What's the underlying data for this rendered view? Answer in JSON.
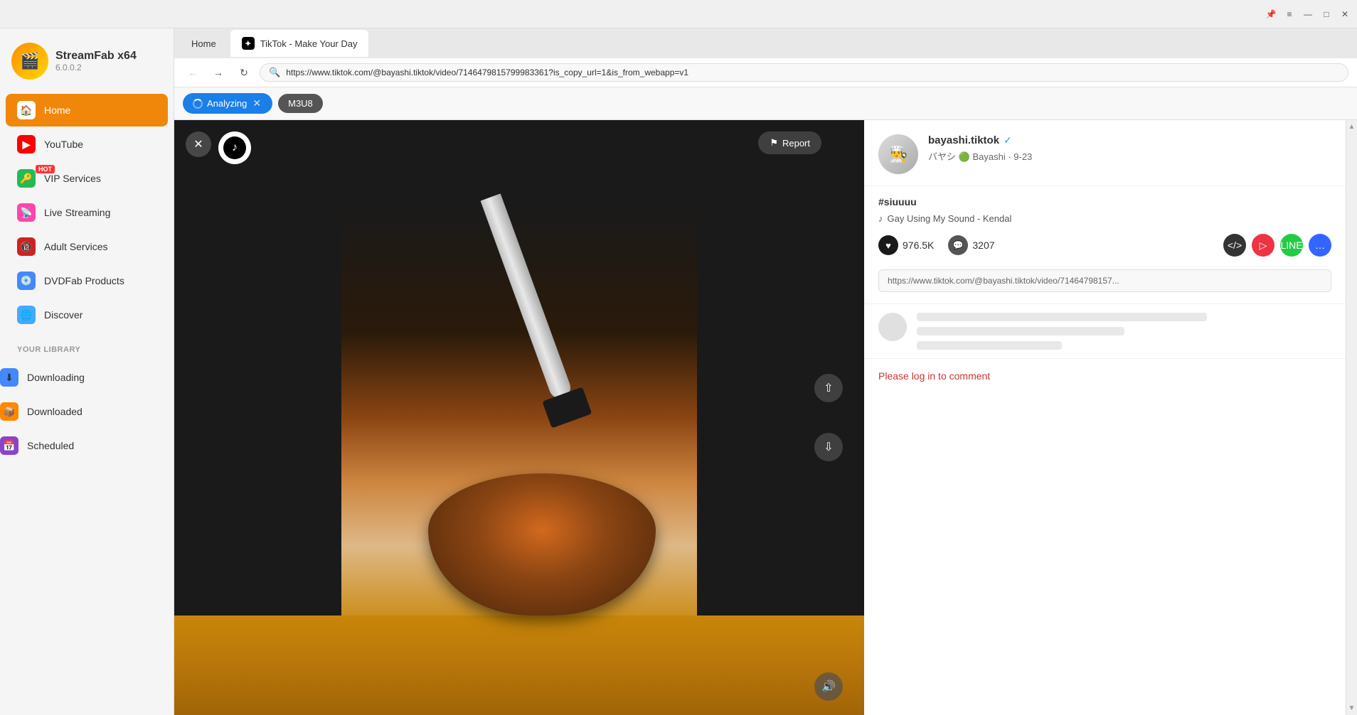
{
  "app": {
    "name": "StreamFab",
    "arch": "x64",
    "version": "6.0.0.2"
  },
  "titleBar": {
    "pin_label": "📌",
    "menu_label": "≡",
    "minimize_label": "—",
    "maximize_label": "□",
    "close_label": "✕"
  },
  "sidebar": {
    "items": [
      {
        "id": "home",
        "label": "Home",
        "active": true
      },
      {
        "id": "youtube",
        "label": "YouTube",
        "active": false
      },
      {
        "id": "vip",
        "label": "VIP Services",
        "active": false,
        "badge": "HOT"
      },
      {
        "id": "live",
        "label": "Live Streaming",
        "active": false
      },
      {
        "id": "adult",
        "label": "Adult Services",
        "active": false
      },
      {
        "id": "dvd",
        "label": "DVDFab Products",
        "active": false
      },
      {
        "id": "discover",
        "label": "Discover",
        "active": false
      }
    ],
    "library": {
      "label": "YOUR LIBRARY",
      "items": [
        {
          "id": "downloading",
          "label": "Downloading"
        },
        {
          "id": "downloaded",
          "label": "Downloaded"
        },
        {
          "id": "scheduled",
          "label": "Scheduled"
        }
      ]
    }
  },
  "browser": {
    "tabs": [
      {
        "id": "home",
        "label": "Home"
      },
      {
        "id": "tiktok",
        "label": "TikTok - Make Your Day",
        "active": true
      }
    ],
    "url": "https://www.tiktok.com/@bayashi.tiktok/video/7146479815799983361?is_copy_url=1&is_from_webapp=v1",
    "analyzing_label": "Analyzing",
    "m3u8_label": "M3U8"
  },
  "video": {
    "report_label": "Report",
    "close_label": "✕"
  },
  "channel": {
    "name": "bayashi.tiktok",
    "sub_text": "バヤシ",
    "sub_detail": "Bayashi · 9-23",
    "tag": "#siuuuu",
    "music": "Gay Using My Sound - Kendal",
    "likes": "976.5K",
    "comments": "3207",
    "url_short": "https://www.tiktok.com/@bayashi.tiktok/video/71464798157..."
  },
  "comments": {
    "login_prompt": "Please log in to comment"
  }
}
